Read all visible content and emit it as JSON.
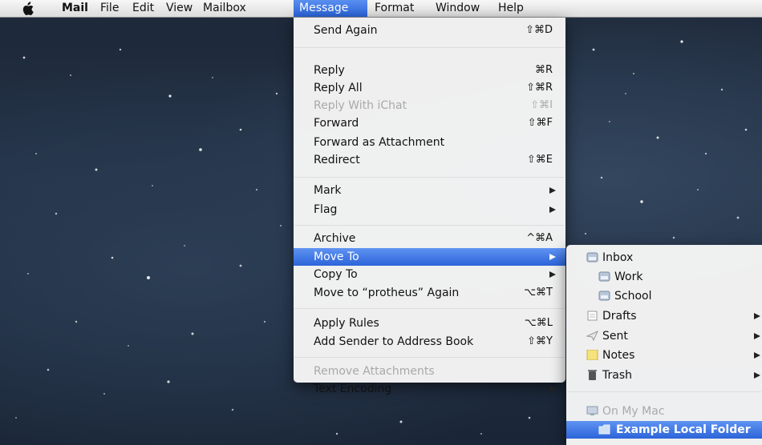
{
  "menubar": {
    "app_name": "Mail",
    "items": [
      "File",
      "Edit",
      "View",
      "Mailbox",
      "Message",
      "Format",
      "Window",
      "Help"
    ],
    "active": "Message"
  },
  "message_menu": {
    "send_again": {
      "label": "Send Again",
      "shortcut": "⇧⌘D"
    },
    "reply": {
      "label": "Reply",
      "shortcut": "⌘R"
    },
    "reply_all": {
      "label": "Reply All",
      "shortcut": "⇧⌘R"
    },
    "reply_ichat": {
      "label": "Reply With iChat",
      "shortcut": "⇧⌘I"
    },
    "forward": {
      "label": "Forward",
      "shortcut": "⇧⌘F"
    },
    "forward_attachment": {
      "label": "Forward as Attachment"
    },
    "redirect": {
      "label": "Redirect",
      "shortcut": "⇧⌘E"
    },
    "mark": {
      "label": "Mark"
    },
    "flag": {
      "label": "Flag"
    },
    "archive": {
      "label": "Archive",
      "shortcut": "^⌘A"
    },
    "move_to": {
      "label": "Move To"
    },
    "copy_to": {
      "label": "Copy To"
    },
    "move_again": {
      "label": "Move to “protheus” Again",
      "shortcut": "⌥⌘T"
    },
    "apply_rules": {
      "label": "Apply Rules",
      "shortcut": "⌥⌘L"
    },
    "add_sender": {
      "label": "Add Sender to Address Book",
      "shortcut": "⇧⌘Y"
    },
    "remove_attachments": {
      "label": "Remove Attachments"
    },
    "text_encoding": {
      "label": "Text Encoding"
    }
  },
  "move_submenu": {
    "inbox": "Inbox",
    "work": "Work",
    "school": "School",
    "drafts": "Drafts",
    "sent": "Sent",
    "notes": "Notes",
    "trash": "Trash",
    "on_my_mac": "On My Mac",
    "example_folder": "Example Local Folder"
  },
  "colors": {
    "highlight": "#2c64d9",
    "menu_bg": "#f6f6f6",
    "desktop": "#1d2838"
  }
}
